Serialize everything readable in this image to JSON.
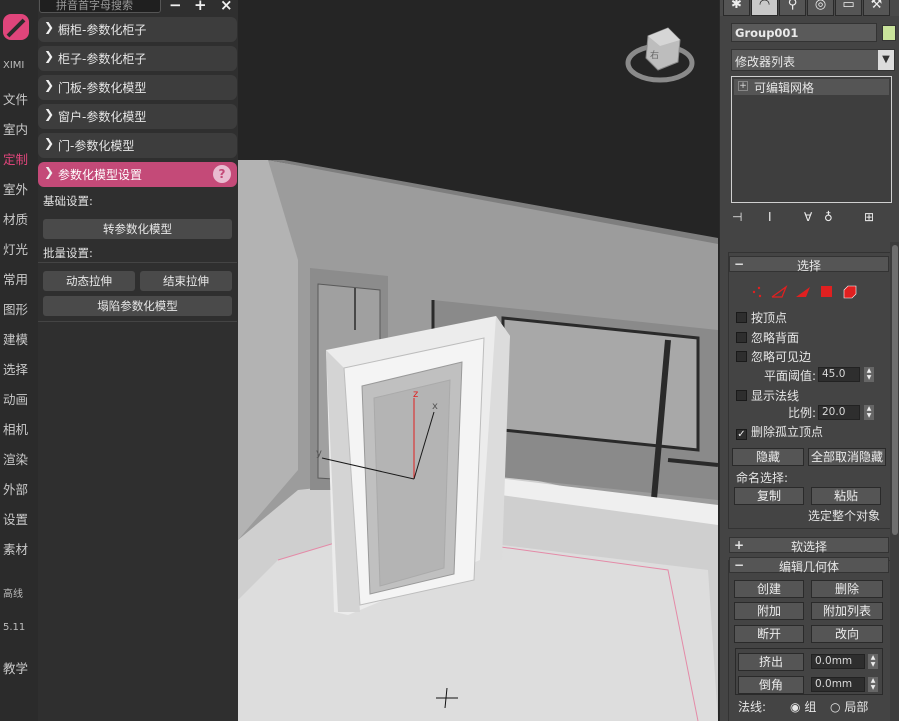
{
  "rail": {
    "brand": "XIMI",
    "items": [
      "文件",
      "室内",
      "定制",
      "室外",
      "材质",
      "灯光",
      "常用",
      "图形",
      "建模",
      "选择",
      "动画",
      "相机",
      "渲染",
      "外部",
      "设置",
      "素材"
    ],
    "active": "定制",
    "extra": [
      "高线",
      "5.11",
      "教学"
    ]
  },
  "plugin": {
    "search_placeholder": "拼音首字母搜索",
    "top_buttons": [
      "−",
      "+",
      "×"
    ],
    "categories": [
      "橱柜-参数化柜子",
      "柜子-参数化柜子",
      "门板-参数化模型",
      "窗户-参数化模型",
      "门-参数化模型"
    ],
    "open_category": "参数化模型设置",
    "help": "?",
    "basic_label": "基础设置:",
    "convert_button": "转参数化模型",
    "batch_label": "批量设置:",
    "dynamic_stretch": "动态拉伸",
    "end_stretch": "结束拉伸",
    "collapse_button": "塌陷参数化模型"
  },
  "viewport": {
    "axis_labels": {
      "x": "x",
      "y": "y",
      "z": "z"
    },
    "viewcube_label": "右"
  },
  "command_panel": {
    "object_name": "Group001",
    "object_color": "#c9e39b",
    "modifier_list": "修改器列表",
    "stack_items": [
      "可编辑网格"
    ],
    "selection": {
      "title": "选择",
      "by_vertex": "按顶点",
      "ignore_backface": "忽略背面",
      "ignore_visible_edges": "忽略可见边",
      "planar_threshold_label": "平面阈值:",
      "planar_threshold": "45.0",
      "show_normals": "显示法线",
      "scale_label": "比例:",
      "scale": "20.0",
      "delete_isolated": "删除孤立顶点",
      "delete_isolated_checked": true,
      "hide": "隐藏",
      "unhide_all": "全部取消隐藏",
      "named_selection": "命名选择:",
      "copy": "复制",
      "paste": "粘贴",
      "select_whole": "选定整个对象"
    },
    "soft_selection": {
      "title": "软选择"
    },
    "edit_geometry": {
      "title": "编辑几何体",
      "create": "创建",
      "delete": "删除",
      "attach": "附加",
      "attach_list": "附加列表",
      "break": "断开",
      "turn": "改向",
      "extrude": "挤出",
      "extrude_value": "0.0mm",
      "chamfer": "倒角",
      "chamfer_value": "0.0mm",
      "normal_label": "法线:",
      "group": "组",
      "local": "局部"
    }
  }
}
